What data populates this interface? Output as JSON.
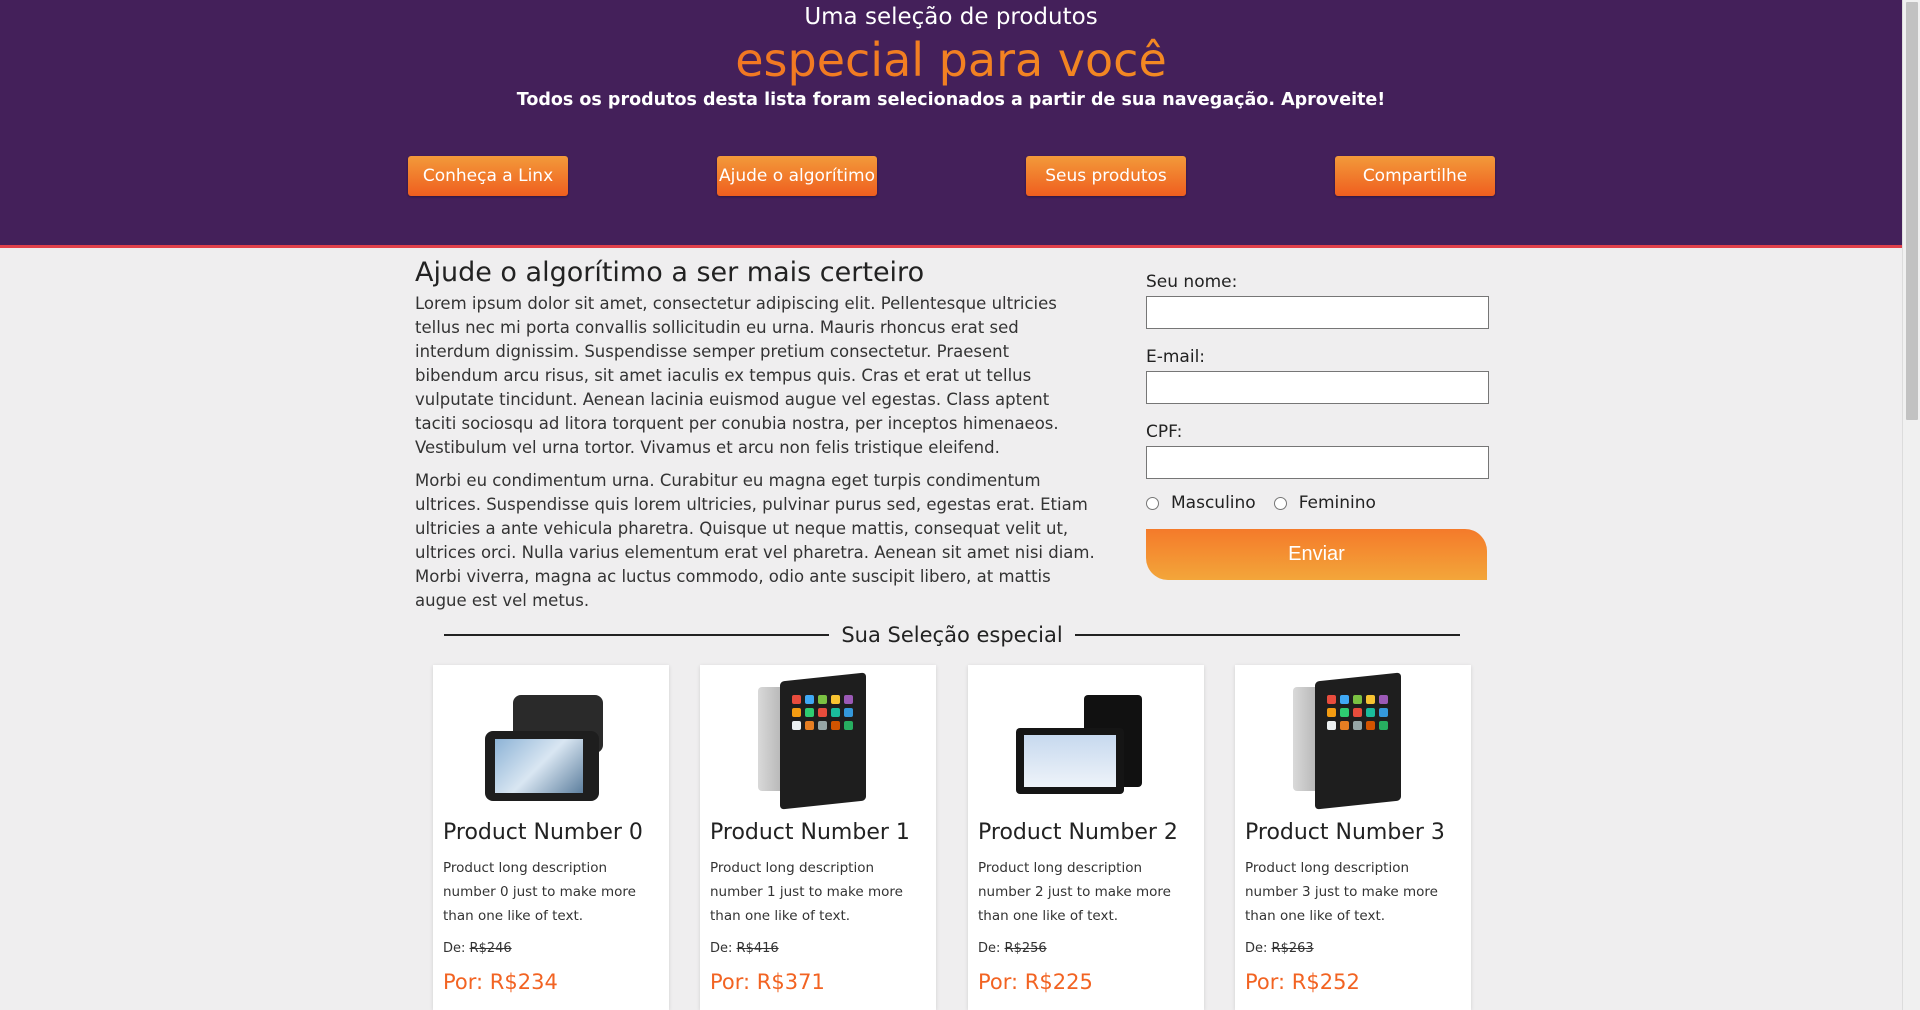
{
  "header": {
    "top_line": "Uma seleção de produtos",
    "highlight": "especial para você",
    "subtitle": "Todos os produtos desta lista foram selecionados a partir de sua navegação. Aproveite!",
    "nav": [
      "Conheça a Linx",
      "Ajude o algorítimo",
      "Seus produtos",
      "Compartilhe"
    ]
  },
  "info": {
    "title": "Ajude o algorítimo a ser mais certeiro",
    "p1": "Lorem ipsum dolor sit amet, consectetur adipiscing elit. Pellentesque ultricies tellus nec mi porta convallis sollicitudin eu urna. Mauris rhoncus erat sed interdum dignissim. Suspendisse semper pretium consectetur. Praesent bibendum arcu risus, sit amet iaculis ex tempus quis. Cras et erat ut tellus vulputate tincidunt. Aenean lacinia euismod augue vel egestas. Class aptent taciti sociosqu ad litora torquent per conubia nostra, per inceptos himenaeos. Vestibulum vel urna tortor. Vivamus et arcu non felis tristique eleifend.",
    "p2": "Morbi eu condimentum urna. Curabitur eu magna eget turpis condimentum ultrices. Suspendisse quis lorem ultricies, pulvinar purus sed, egestas erat. Etiam ultricies a ante vehicula pharetra. Quisque ut neque mattis, consequat velit ut, ultrices orci. Nulla varius elementum erat vel pharetra. Aenean sit amet nisi diam. Morbi viverra, magna ac luctus commodo, odio ante suscipit libero, at mattis augue est vel metus."
  },
  "form": {
    "name_label": "Seu nome:",
    "name_value": "",
    "email_label": "E-mail:",
    "email_value": "",
    "cpf_label": "CPF:",
    "cpf_value": "",
    "gender_options": [
      "Masculino",
      "Feminino"
    ],
    "submit_label": "Enviar"
  },
  "selection": {
    "title": "Sua Seleção especial"
  },
  "products": [
    {
      "name": "Product Number 0",
      "description": "Product long description number 0 just to make more than one like of text.",
      "de_label": "De:",
      "old_price": "R$246",
      "new_price": "Por: R$234",
      "image_icon": "tablet-black-icon"
    },
    {
      "name": "Product Number 1",
      "description": "Product long description number 1 just to make more than one like of text.",
      "de_label": "De:",
      "old_price": "R$416",
      "new_price": "Por: R$371",
      "image_icon": "tablet-silver-icon"
    },
    {
      "name": "Product Number 2",
      "description": "Product long description number 2 just to make more than one like of text.",
      "de_label": "De:",
      "old_price": "R$256",
      "new_price": "Por: R$225",
      "image_icon": "tablet-landscape-icon"
    },
    {
      "name": "Product Number 3",
      "description": "Product long description number 3 just to make more than one like of text.",
      "de_label": "De:",
      "old_price": "R$263",
      "new_price": "Por: R$252",
      "image_icon": "tablet-silver-icon"
    }
  ],
  "colors": {
    "header_bg": "#44205a",
    "accent_orange": "#f26322",
    "header_border": "#e0404a"
  }
}
